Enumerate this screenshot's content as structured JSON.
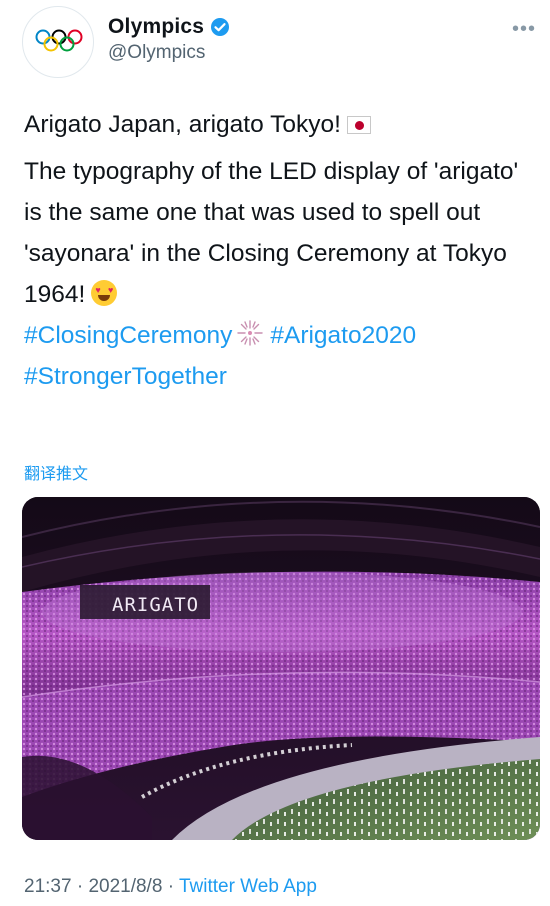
{
  "account": {
    "display_name": "Olympics",
    "handle": "@Olympics",
    "avatar_icon": "olympic-rings-icon",
    "verified": true
  },
  "tweet": {
    "line1": "Arigato Japan, arigato Tokyo!",
    "body": "The typography of the LED display of 'arigato' is the same one that was used to spell out 'sayonara' in the Closing Ceremony at Tokyo 1964!",
    "hashtags": [
      "#ClosingCeremony",
      "#Arigato2020",
      "#StrongerTogether"
    ],
    "emojis": [
      "japan-flag",
      "heart-eyes",
      "fireworks"
    ]
  },
  "translate_label": "翻译推文",
  "media": {
    "led_text": "ARIGATO"
  },
  "footer": {
    "time": "21:37",
    "date": "2021/8/8",
    "separator": "·",
    "source": "Twitter Web App"
  },
  "colors": {
    "link": "#1d9bf0",
    "secondary": "#536471",
    "verified": "#1d9bf0"
  }
}
